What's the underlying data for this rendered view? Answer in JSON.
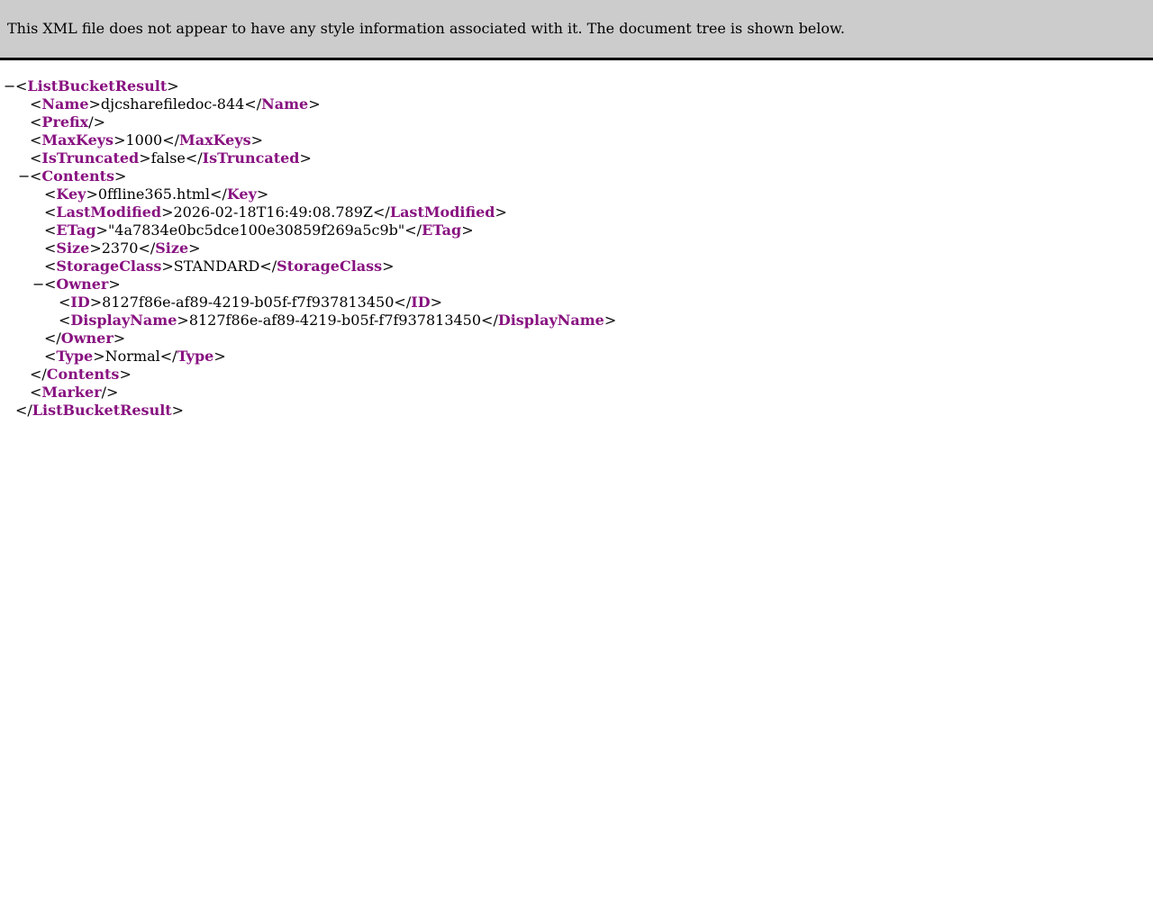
{
  "header": {
    "message": "This XML file does not appear to have any style information associated with it. The document tree is shown below."
  },
  "fold_glyph": "−",
  "xml": {
    "root_tag": "ListBucketResult",
    "name_tag": "Name",
    "name_value": "djcsharefiledoc-844",
    "prefix_tag": "Prefix",
    "maxkeys_tag": "MaxKeys",
    "maxkeys_value": "1000",
    "istruncated_tag": "IsTruncated",
    "istruncated_value": "false",
    "contents_tag": "Contents",
    "key_tag": "Key",
    "key_value": "0ffline365.html",
    "lastmodified_tag": "LastModified",
    "lastmodified_value": "2026-02-18T16:49:08.789Z",
    "etag_tag": "ETag",
    "etag_value": "\"4a7834e0bc5dce100e30859f269a5c9b\"",
    "size_tag": "Size",
    "size_value": "2370",
    "storageclass_tag": "StorageClass",
    "storageclass_value": "STANDARD",
    "owner_tag": "Owner",
    "id_tag": "ID",
    "id_value": "8127f86e-af89-4219-b05f-f7f937813450",
    "displayname_tag": "DisplayName",
    "displayname_value": "8127f86e-af89-4219-b05f-f7f937813450",
    "type_tag": "Type",
    "type_value": "Normal",
    "marker_tag": "Marker"
  }
}
